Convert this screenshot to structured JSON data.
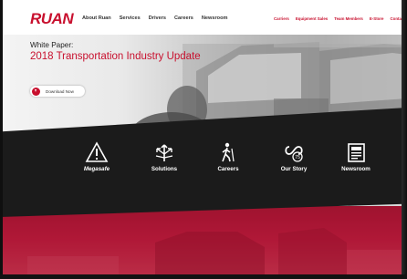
{
  "brand": {
    "logo": "RUAN",
    "color": "#c8102e"
  },
  "main_nav": [
    {
      "label": "About Ruan"
    },
    {
      "label": "Services"
    },
    {
      "label": "Drivers"
    },
    {
      "label": "Careers"
    },
    {
      "label": "Newsroom"
    }
  ],
  "utility_nav": [
    {
      "label": "Carriers"
    },
    {
      "label": "Equipment Sales"
    },
    {
      "label": "Team Members"
    },
    {
      "label": "E-Store"
    },
    {
      "label": "Contact"
    }
  ],
  "hero": {
    "kicker": "White Paper:",
    "title": "2018 Transportation Industry Update",
    "download_label": "Download Now"
  },
  "feature_links": [
    {
      "label": "Megasafe",
      "icon": "warning-icon"
    },
    {
      "label": "Solutions",
      "icon": "solutions-arrows-icon"
    },
    {
      "label": "Careers",
      "icon": "hiker-icon"
    },
    {
      "label": "Our Story",
      "icon": "infinity-story-icon"
    },
    {
      "label": "Newsroom",
      "icon": "newspaper-icon"
    }
  ]
}
